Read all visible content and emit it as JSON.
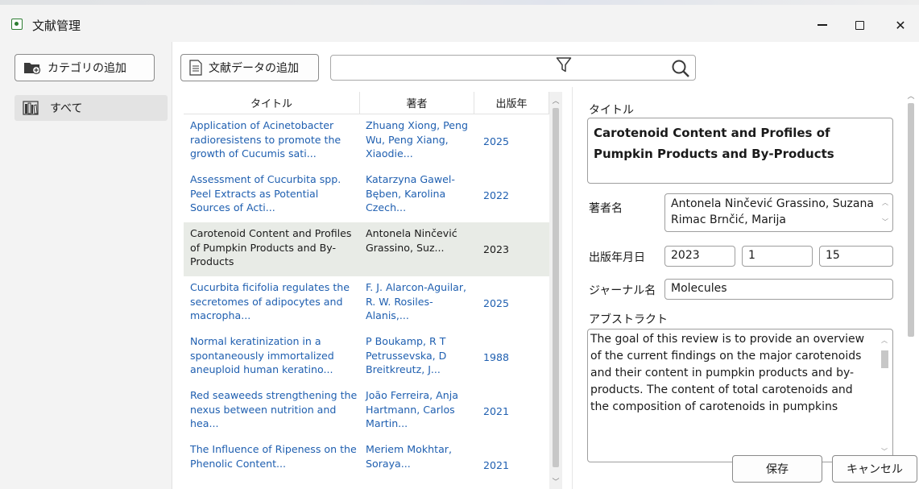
{
  "window": {
    "title": "文献管理",
    "minimize_glyph": "—",
    "close_glyph": "✕"
  },
  "sidebar": {
    "add_category_label": "カテゴリの追加",
    "categories": [
      {
        "label": "すべて",
        "icon": "bookshelf-icon"
      }
    ]
  },
  "toolbar": {
    "add_document_label": "文献データの追加",
    "search": {
      "value": "",
      "placeholder": ""
    }
  },
  "table": {
    "headers": {
      "title": "タイトル",
      "author": "著者",
      "year": "出版年"
    },
    "rows": [
      {
        "title": "Application of Acinetobacter radioresistens to promote the growth of Cucumis sati...",
        "author": "Zhuang Xiong, Peng Wu, Peng Xiang, Xiaodie...",
        "year": "2025"
      },
      {
        "title": "Assessment of Cucurbita spp. Peel Extracts as Potential Sources of Acti...",
        "author": "Katarzyna Gawel-Bęben, Karolina Czech...",
        "year": "2022"
      },
      {
        "title": "Carotenoid Content and Profiles of Pumpkin Products and By-Products",
        "author": "Antonela Ninčević Grassino, Suz...",
        "year": "2023"
      },
      {
        "title": "Cucurbita ficifolia regulates the secretomes of adipocytes and macropha...",
        "author": "F. J. Alarcon-Aguilar, R. W. Rosiles-Alanis,...",
        "year": "2025"
      },
      {
        "title": "Normal keratinization in a spontaneously immortalized aneuploid human keratino...",
        "author": "P Boukamp, R T Petrussevska, D Breitkreutz, J...",
        "year": "1988"
      },
      {
        "title": "Red seaweeds strengthening the nexus between nutrition and hea...",
        "author": "João Ferreira, Anja Hartmann, Carlos Martin...",
        "year": "2021"
      },
      {
        "title": "The Influence of Ripeness on the Phenolic Content...",
        "author": "Meriem Mokhtar, Soraya...",
        "year": "2021"
      }
    ],
    "selected_index": 2
  },
  "detail": {
    "title_label": "タイトル",
    "title_value": "Carotenoid Content and Profiles of Pumpkin Products and By-Products",
    "author_label": "著者名",
    "author_value": "Antonela Ninčević Grassino, Suzana Rimac Brnčić, Marija",
    "date_label": "出版年月日",
    "year_value": "2023",
    "month_value": "1",
    "day_value": "15",
    "journal_label": "ジャーナル名",
    "journal_value": "Molecules",
    "abstract_label": "アブストラクト",
    "abstract_value": "The goal of this review is to provide an overview of the current findings on the major carotenoids and their content in pumpkin products and by-products. The content of total carotenoids and the composition of carotenoids in pumpkins",
    "save_label": "保存",
    "cancel_label": "キャンセル"
  },
  "colors": {
    "link_text": "#1f5fb0",
    "selected_row": "#e8ebe6",
    "chrome": "#f3f3f3"
  }
}
